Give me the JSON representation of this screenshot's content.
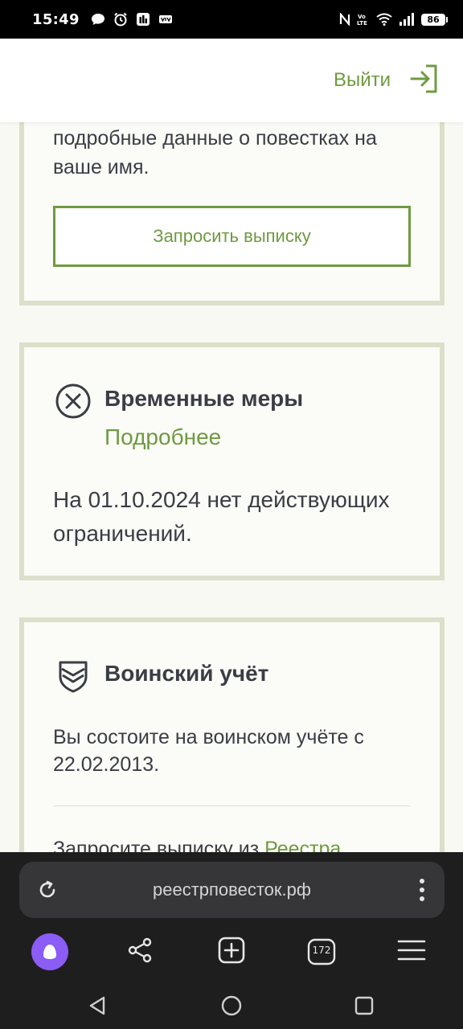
{
  "status_bar": {
    "time": "15:49",
    "battery": "86",
    "left_icons": [
      "chat-icon",
      "alarm-icon",
      "app-icon",
      "vpn-icon"
    ],
    "right_icons": [
      "nfc-icon",
      "volte-icon",
      "wifi-icon",
      "signal-icon"
    ]
  },
  "header": {
    "logout_label": "Выйти"
  },
  "summons_card": {
    "text": "подробные данные о повестках на ваше имя.",
    "button_label": "Запросить выписку"
  },
  "temporary_measures": {
    "title": "Временные меры",
    "more_link": "Подробнее",
    "text": "На 01.10.2024 нет действующих ограничений."
  },
  "military_registration": {
    "title": "Воинский учёт",
    "text": "Вы состоите на воинском учёте с 22.02.2013.",
    "request_text": "Запросите выписку из ",
    "request_link": "Реестра"
  },
  "browser": {
    "url": "реестрповесток.рф",
    "tabs_count": "172"
  },
  "colors": {
    "accent": "#6f9a41",
    "card_border": "#dcdfca",
    "text": "#3a3d44",
    "alice": "#8b5cf6"
  }
}
